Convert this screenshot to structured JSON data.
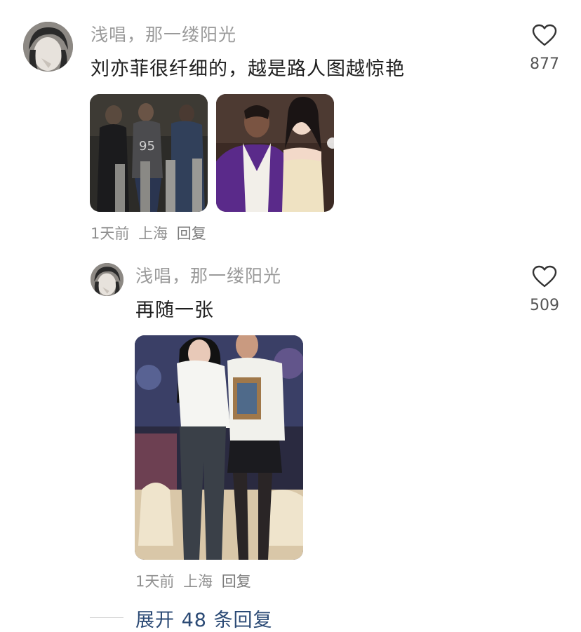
{
  "comment": {
    "username": "浅唱，那一缕阳光",
    "text": "刘亦菲很纤细的，越是路人图越惊艳",
    "likes": "877",
    "time": "1天前",
    "location": "上海",
    "reply_label": "回复"
  },
  "reply": {
    "username": "浅唱，那一缕阳光",
    "text": "再随一张",
    "likes": "509",
    "time": "1天前",
    "location": "上海",
    "reply_label": "回复"
  },
  "expand_label": "展开 48 条回复",
  "icons": {
    "like": "heart-outline-icon",
    "avatar": "user-avatar"
  },
  "colors": {
    "username": "#9a9a9a",
    "text": "#1f1f1f",
    "expand": "#2b4a75"
  }
}
